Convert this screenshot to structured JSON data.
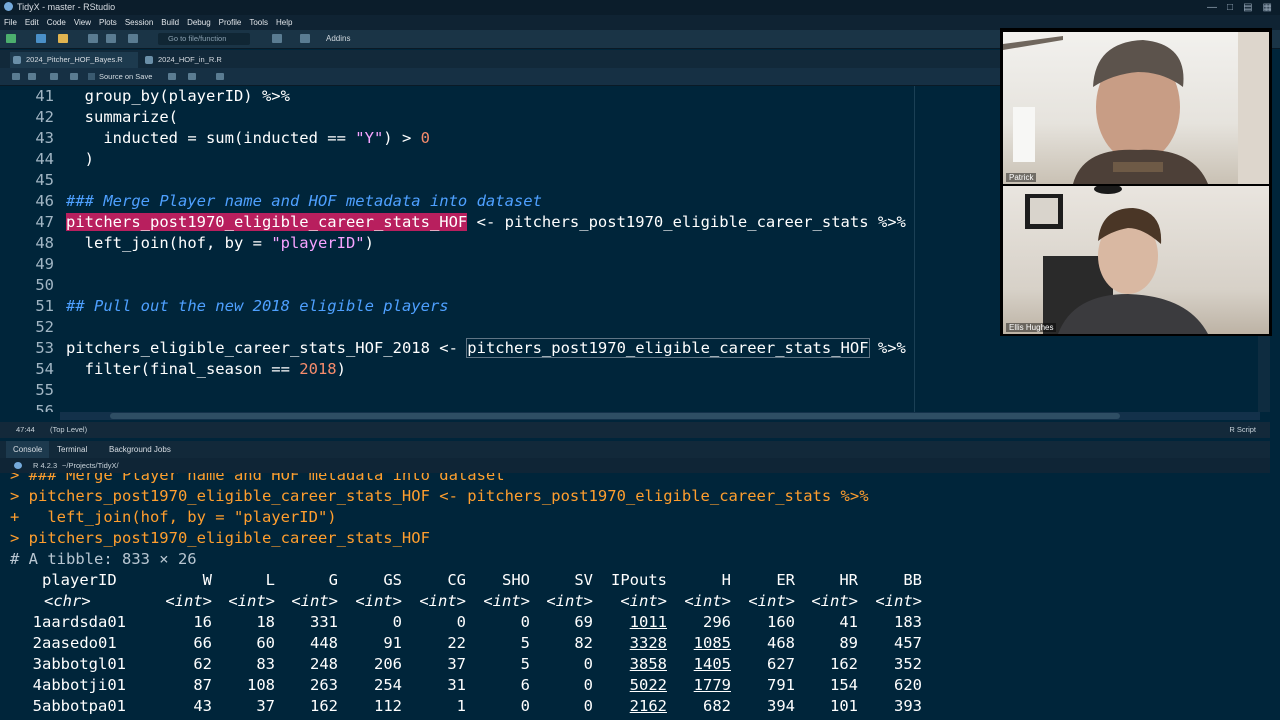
{
  "window": {
    "title": "TidyX - master - RStudio",
    "controls": [
      "minimize-icon",
      "maximize-icon",
      "restore-icon",
      "grid-icon"
    ]
  },
  "menu": [
    "File",
    "Edit",
    "Code",
    "View",
    "Plots",
    "Session",
    "Build",
    "Debug",
    "Profile",
    "Tools",
    "Help"
  ],
  "toolbar": {
    "goto_placeholder": "Go to file/function",
    "addins_label": "Addins"
  },
  "editor": {
    "tabs": [
      {
        "label": "2024_Pitcher_HOF_Bayes.R",
        "active": true
      },
      {
        "label": "2024_HOF_in_R.R",
        "active": false
      }
    ],
    "source_on_save": "Source on Save",
    "lines": [
      {
        "n": "41",
        "text": "  group_by(playerID) %>%"
      },
      {
        "n": "42",
        "text": "  summarize("
      },
      {
        "n": "43",
        "text_a": "    inducted = sum(inducted == ",
        "str": "\"Y\"",
        "text_b": ") > ",
        "num": "0"
      },
      {
        "n": "44",
        "text": "  )"
      },
      {
        "n": "45",
        "text": ""
      },
      {
        "n": "46",
        "comment": "### Merge Player name and HOF metadata into dataset"
      },
      {
        "n": "47",
        "selected": "pitchers_post1970_eligible_career_stats_HOF",
        "rest": " <- pitchers_post1970_eligible_career_stats %>%"
      },
      {
        "n": "48",
        "text_a": "  left_join(hof, by = ",
        "str": "\"playerID\"",
        "text_b": ")"
      },
      {
        "n": "49",
        "text": ""
      },
      {
        "n": "50",
        "text": ""
      },
      {
        "n": "51",
        "comment": "## Pull out the new 2018 eligible players"
      },
      {
        "n": "52",
        "text": ""
      },
      {
        "n": "53",
        "text_a": "pitchers_eligible_career_stats_HOF_2018 <- ",
        "boxed": "pitchers_post1970_eligible_career_stats_HOF",
        "text_b": " %>%"
      },
      {
        "n": "54",
        "text_a": "  filter(final_season == ",
        "num": "2018",
        "text_b": ")"
      },
      {
        "n": "55",
        "text": ""
      },
      {
        "n": "56",
        "text": ""
      }
    ],
    "status_pos": "47:44",
    "status_scope": "(Top Level)",
    "status_lang": "R Script"
  },
  "console": {
    "tabs": [
      "Console",
      "Terminal",
      "Background Jobs"
    ],
    "r_version": "R 4.2.3",
    "path": "~/Projects/TidyX/",
    "lines": [
      {
        "kind": "echo",
        "text": "> ### Merge Player name and HOF metadata into dataset"
      },
      {
        "kind": "echo",
        "text": "> pitchers_post1970_eligible_career_stats_HOF <- pitchers_post1970_eligible_career_stats %>%"
      },
      {
        "kind": "echo",
        "text": "+   left_join(hof, by = \"playerID\")"
      },
      {
        "kind": "echo",
        "text": "> pitchers_post1970_eligible_career_stats_HOF"
      },
      {
        "kind": "meta",
        "text": "# A tibble: 833 × 26"
      }
    ],
    "tibble": {
      "columns": [
        "playerID",
        "W",
        "L",
        "G",
        "GS",
        "CG",
        "SHO",
        "SV",
        "IPouts",
        "H",
        "ER",
        "HR",
        "BB"
      ],
      "types": [
        "<chr>",
        "<int>",
        "<int>",
        "<int>",
        "<int>",
        "<int>",
        "<int>",
        "<int>",
        "<int>",
        "<int>",
        "<int>",
        "<int>",
        "<int>"
      ],
      "rows": [
        [
          "1",
          "aardsda01",
          "16",
          "18",
          "331",
          "0",
          "0",
          "0",
          "69",
          "1011",
          "296",
          "160",
          "41",
          "183"
        ],
        [
          "2",
          "aasedo01",
          "66",
          "60",
          "448",
          "91",
          "22",
          "5",
          "82",
          "3328",
          "1085",
          "468",
          "89",
          "457"
        ],
        [
          "3",
          "abbotgl01",
          "62",
          "83",
          "248",
          "206",
          "37",
          "5",
          "0",
          "3858",
          "1405",
          "627",
          "162",
          "352"
        ],
        [
          "4",
          "abbotji01",
          "87",
          "108",
          "263",
          "254",
          "31",
          "6",
          "0",
          "5022",
          "1779",
          "791",
          "154",
          "620"
        ],
        [
          "5",
          "abbotpa01",
          "43",
          "37",
          "162",
          "112",
          "1",
          "0",
          "0",
          "2162",
          "682",
          "394",
          "101",
          "393"
        ]
      ]
    }
  },
  "webcams": [
    {
      "name": "Patrick"
    },
    {
      "name": "Ellis Hughes"
    }
  ],
  "colors": {
    "editor_bg": "#00253a",
    "selection": "#b81f5e",
    "comment": "#4ea0ff",
    "string": "#f6a3ff",
    "number": "#f78c6c",
    "console_echo": "#ff9e2e"
  }
}
